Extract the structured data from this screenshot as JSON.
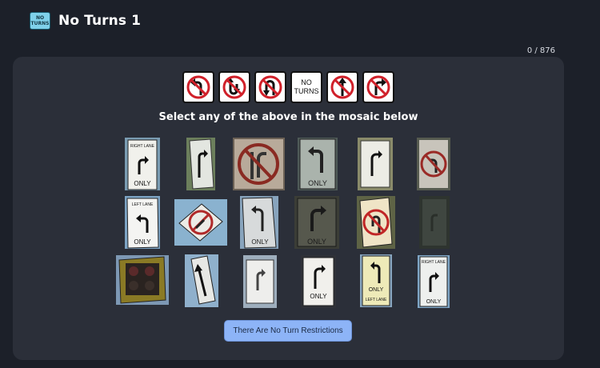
{
  "header": {
    "icon_line1": "NO",
    "icon_line2": "TURNS",
    "title": "No Turns 1"
  },
  "progress": "0 / 876",
  "reference_signs": [
    {
      "icon": "no-left-turn-icon"
    },
    {
      "icon": "no-u-turn-left-icon"
    },
    {
      "icon": "no-u-turn-icon"
    },
    {
      "icon": "no-turns-text",
      "line1": "NO",
      "line2": "TURNS"
    },
    {
      "icon": "no-straight-icon"
    },
    {
      "icon": "no-right-turn-icon"
    }
  ],
  "instruction": "Select any of the above in the mosaic below",
  "mosaic": [
    {
      "name": "right-lane-only-sign",
      "top_text": "RIGHT LANE",
      "bottom_text": "ONLY"
    },
    {
      "name": "right-arrow-sign"
    },
    {
      "name": "no-straight-or-right-sign"
    },
    {
      "name": "left-arrow-only-sign",
      "bottom_text": "ONLY"
    },
    {
      "name": "right-arrow-sign-2"
    },
    {
      "name": "no-left-turn-sign"
    },
    {
      "name": "left-lane-only-sign",
      "top_text": "LEFT LANE",
      "bottom_text": "ONLY"
    },
    {
      "name": "no-u-turn-tilted-sign"
    },
    {
      "name": "left-arrow-only-sign-2",
      "bottom_text": "ONLY"
    },
    {
      "name": "right-arrow-only-sign",
      "bottom_text": "ONLY"
    },
    {
      "name": "no-u-turn-sign"
    },
    {
      "name": "faded-sign"
    },
    {
      "name": "traffic-light"
    },
    {
      "name": "tilted-arrow-sign"
    },
    {
      "name": "arrow-sign-small"
    },
    {
      "name": "right-turn-only-sign",
      "bottom_text": "ONLY"
    },
    {
      "name": "left-lane-only-arrow-sign",
      "mid_text": "ONLY",
      "bottom_text": "LEFT LANE"
    },
    {
      "name": "right-lane-only-sign-2",
      "top_text": "RIGHT LANE",
      "bottom_text": "ONLY"
    }
  ],
  "button_label": "There Are No Turn Restrictions"
}
